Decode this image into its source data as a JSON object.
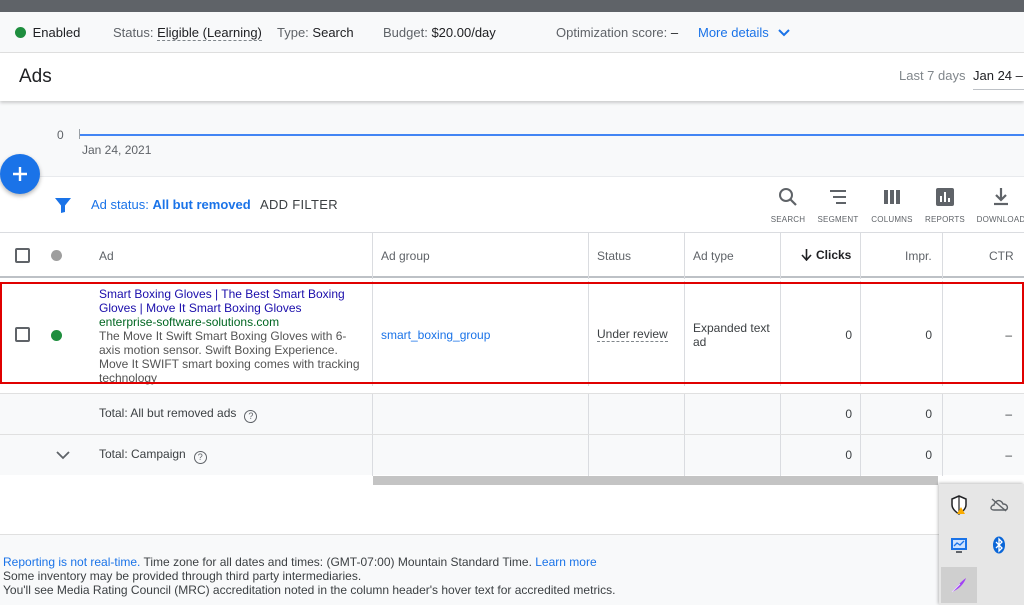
{
  "status": {
    "enabled_label": "Enabled",
    "status_label": "Status:",
    "status_value": "Eligible (Learning)",
    "type_label": "Type:",
    "type_value": "Search",
    "budget_label": "Budget:",
    "budget_value": "$20.00/day",
    "optimization_label": "Optimization score:",
    "optimization_value": "–",
    "more_details": "More details",
    "enabled_color": "#1e8e3e"
  },
  "header": {
    "title": "Ads",
    "range_label": "Last 7 days",
    "range_value": "Jan 24 –"
  },
  "chart": {
    "y_tick": "0",
    "x_tick": "Jan 24, 2021"
  },
  "filter": {
    "label": "Ad status:",
    "value": "All but removed",
    "add_filter": "ADD FILTER"
  },
  "toolbar": {
    "search": "SEARCH",
    "segment": "SEGMENT",
    "columns": "COLUMNS",
    "reports": "REPORTS",
    "download": "DOWNLOAD"
  },
  "table": {
    "columns": {
      "ad": "Ad",
      "ad_group": "Ad group",
      "status": "Status",
      "ad_type": "Ad type",
      "clicks": "Clicks",
      "impr": "Impr.",
      "ctr": "CTR"
    },
    "rows": [
      {
        "headline": "Smart Boxing Gloves | The Best Smart Boxing Gloves | Move It Smart Boxing Gloves",
        "url": "enterprise-software-solutions.com",
        "description": "The Move It Swift Smart Boxing Gloves with 6-axis motion sensor. Swift Boxing Experience. Move It SWIFT smart boxing comes with tracking technology",
        "ad_group": "smart_boxing_group",
        "status": "Under review",
        "ad_type": "Expanded text ad",
        "clicks": "0",
        "impr": "0",
        "ctr": "–"
      }
    ],
    "totals": [
      {
        "label": "Total: All but removed ads",
        "clicks": "0",
        "impr": "0",
        "ctr": "–"
      },
      {
        "label": "Total: Campaign",
        "clicks": "0",
        "impr": "0",
        "ctr": "–"
      }
    ]
  },
  "footer": {
    "line1_link": "Reporting is not real-time.",
    "line1_text": " Time zone for all dates and times: (GMT-07:00) Mountain Standard Time. ",
    "line1_learn": "Learn more",
    "line2": "Some inventory may be provided through third party intermediaries.",
    "line3": "You'll see Media Rating Council (MRC) accreditation noted in the column header's hover text for accredited metrics."
  },
  "colors": {
    "accent": "#1a73e8",
    "headline": "#1a0dab",
    "display_url": "#006621",
    "highlight": "#e00000"
  }
}
